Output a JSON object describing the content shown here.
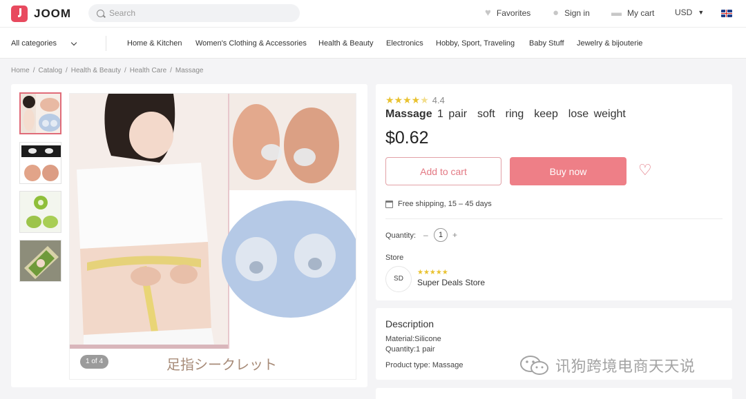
{
  "header": {
    "brand": "JOOM",
    "search_placeholder": "Search",
    "favorites": "Favorites",
    "sign_in": "Sign in",
    "cart": "My cart",
    "currency": "USD"
  },
  "categories": {
    "all": "All categories",
    "items": [
      "Home & Kitchen",
      "Women's Clothing & Accessories",
      "Health & Beauty",
      "Electronics",
      "Hobby, Sport, Traveling",
      "Baby Stuff",
      "Jewelry & bijouterie"
    ]
  },
  "breadcrumb": [
    "Home",
    "/",
    "Catalog",
    "/",
    "Health & Beauty",
    "/",
    "Health Care",
    "/",
    "Massage"
  ],
  "gallery": {
    "counter": "1 of 4",
    "image_caption": "足指シークレット"
  },
  "product": {
    "rating_value": "4.4",
    "rating_stars": 4.4,
    "title_bold": "Massage",
    "title_rest": "1 pair  soft  ring  keep  lose weight",
    "price": "$0.62",
    "add_to_cart": "Add to cart",
    "buy_now": "Buy now",
    "shipping": "Free shipping, 15 – 45 days",
    "quantity_label": "Quantity:",
    "quantity_minus": "–",
    "quantity_value": "1",
    "quantity_plus": "+",
    "store_label": "Store",
    "store_initials": "SD",
    "store_name": "Super Deals Store"
  },
  "description": {
    "title": "Description",
    "lines": [
      "Material:Silicone",
      "Quantity:1 pair",
      "Product type: Massage"
    ]
  },
  "watermark": "讯狗跨境电商天天说",
  "colors": {
    "accent": "#ee7f87",
    "accent_border": "#e2a0a6",
    "star": "#e9c230"
  }
}
